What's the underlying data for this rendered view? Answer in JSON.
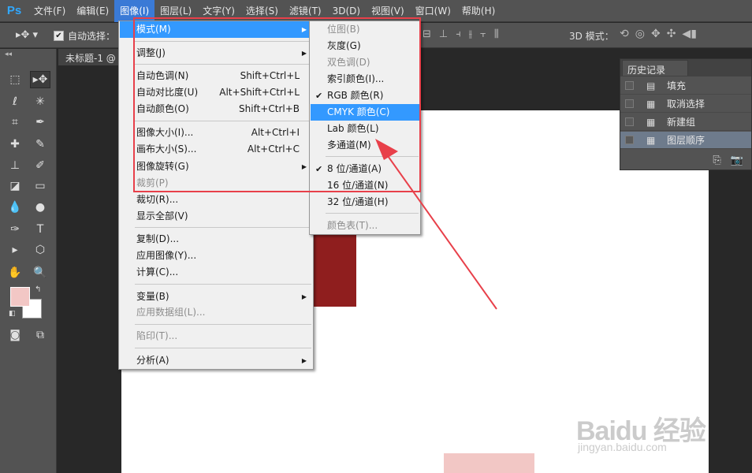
{
  "app": {
    "logo": "Ps"
  },
  "menubar": {
    "items": [
      {
        "label": "文件(F)"
      },
      {
        "label": "编辑(E)"
      },
      {
        "label": "图像(I)"
      },
      {
        "label": "图层(L)"
      },
      {
        "label": "文字(Y)"
      },
      {
        "label": "选择(S)"
      },
      {
        "label": "滤镜(T)"
      },
      {
        "label": "3D(D)"
      },
      {
        "label": "视图(V)"
      },
      {
        "label": "窗口(W)"
      },
      {
        "label": "帮助(H)"
      }
    ]
  },
  "options": {
    "auto_select_label": "自动选择：",
    "auto_select_checked": true,
    "mode_3d_label": "3D 模式："
  },
  "document": {
    "tab_title": "未标题-1 @"
  },
  "colors": {
    "foreground": "#f2c7c5",
    "background": "#ffffff",
    "dark_red_shape": "#8f1e1e",
    "menu_highlight": "#3399ff",
    "annotation_red": "#e8404a"
  },
  "history": {
    "title": "历史记录",
    "items": [
      {
        "label": "填充",
        "icon": "fill-state-icon"
      },
      {
        "label": "取消选择",
        "icon": "document-state-icon"
      },
      {
        "label": "新建组",
        "icon": "document-state-icon"
      },
      {
        "label": "图层顺序",
        "icon": "document-state-icon",
        "selected": true
      }
    ]
  },
  "image_menu": {
    "mode": "模式(M)",
    "adjust": "调整(J)",
    "auto_tone": "自动色调(N)",
    "auto_tone_sc": "Shift+Ctrl+L",
    "auto_contrast": "自动对比度(U)",
    "auto_contrast_sc": "Alt+Shift+Ctrl+L",
    "auto_color": "自动颜色(O)",
    "auto_color_sc": "Shift+Ctrl+B",
    "image_size": "图像大小(I)...",
    "image_size_sc": "Alt+Ctrl+I",
    "canvas_size": "画布大小(S)...",
    "canvas_size_sc": "Alt+Ctrl+C",
    "image_rotation": "图像旋转(G)",
    "crop": "裁剪(P)",
    "trim": "裁切(R)...",
    "reveal_all": "显示全部(V)",
    "duplicate": "复制(D)...",
    "apply_image": "应用图像(Y)...",
    "calculations": "计算(C)...",
    "variables": "变量(B)",
    "apply_dataset": "应用数据组(L)...",
    "trap": "陷印(T)...",
    "analysis": "分析(A)"
  },
  "mode_submenu": {
    "bitmap": "位图(B)",
    "grayscale": "灰度(G)",
    "duotone": "双色调(D)",
    "indexed": "索引颜色(I)...",
    "rgb": "RGB 颜色(R)",
    "cmyk": "CMYK 颜色(C)",
    "lab": "Lab 颜色(L)",
    "multichannel": "多通道(M)",
    "bit8": "8 位/通道(A)",
    "bit16": "16 位/通道(N)",
    "bit32": "32 位/通道(H)",
    "color_table": "颜色表(T)..."
  },
  "watermark": {
    "logo": "Baidu 经验",
    "url": "jingyan.baidu.com"
  }
}
